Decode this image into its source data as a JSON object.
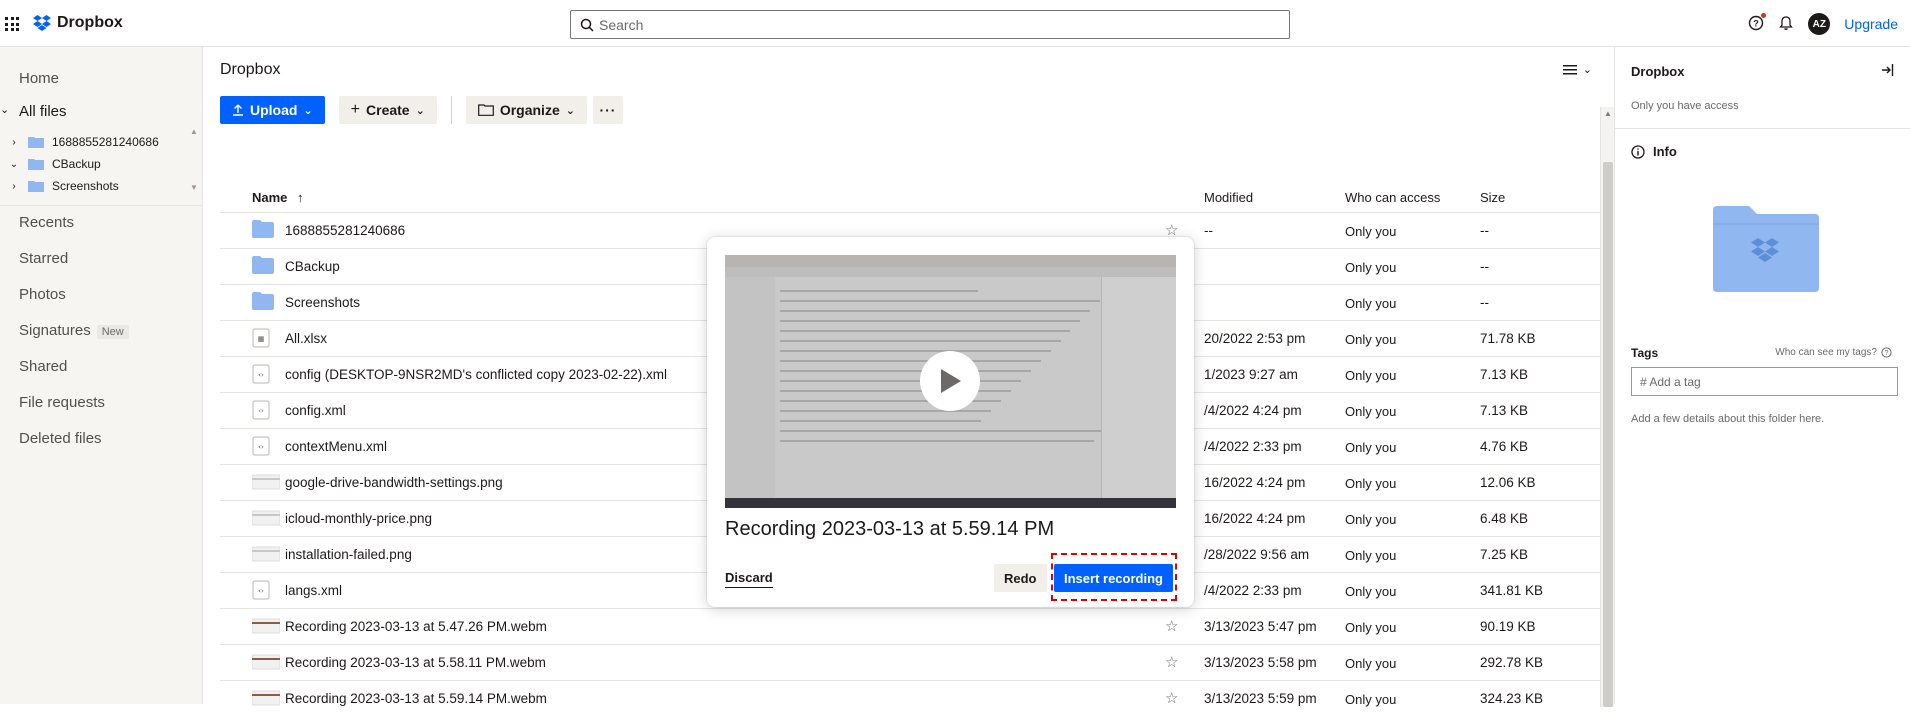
{
  "app": {
    "brand": "Dropbox"
  },
  "search": {
    "placeholder": "Search"
  },
  "topbar": {
    "avatar": "AZ",
    "upgrade": "Upgrade"
  },
  "sidebar": {
    "home": "Home",
    "all_files": "All files",
    "tree": [
      "1688855281240686",
      "CBackup",
      "Screenshots"
    ],
    "recents": "Recents",
    "starred": "Starred",
    "photos": "Photos",
    "signatures": "Signatures",
    "signatures_badge": "New",
    "shared": "Shared",
    "file_requests": "File requests",
    "deleted": "Deleted files"
  },
  "main": {
    "title": "Dropbox",
    "upload": "Upload",
    "create": "Create",
    "organize": "Organize"
  },
  "table": {
    "headers": {
      "name": "Name",
      "modified": "Modified",
      "access": "Who can access",
      "size": "Size"
    },
    "rows": [
      {
        "name": "1688855281240686",
        "type": "folder",
        "modified": "--",
        "access": "Only you",
        "size": "--"
      },
      {
        "name": "CBackup",
        "type": "folder",
        "modified": "",
        "access": "Only you",
        "size": "--"
      },
      {
        "name": "Screenshots",
        "type": "folder",
        "modified": "",
        "access": "Only you",
        "size": "--"
      },
      {
        "name": "All.xlsx",
        "type": "xlsx",
        "modified": "20/2022 2:53 pm",
        "access": "Only you",
        "size": "71.78 KB"
      },
      {
        "name": "config (DESKTOP-9NSR2MD's conflicted copy 2023-02-22).xml",
        "type": "xml",
        "modified": "1/2023 9:27 am",
        "access": "Only you",
        "size": "7.13 KB"
      },
      {
        "name": "config.xml",
        "type": "xml",
        "modified": "/4/2022 4:24 pm",
        "access": "Only you",
        "size": "7.13 KB"
      },
      {
        "name": "contextMenu.xml",
        "type": "xml",
        "modified": "/4/2022 2:33 pm",
        "access": "Only you",
        "size": "4.76 KB"
      },
      {
        "name": "google-drive-bandwidth-settings.png",
        "type": "png",
        "modified": "16/2022 4:24 pm",
        "access": "Only you",
        "size": "12.06 KB"
      },
      {
        "name": "icloud-monthly-price.png",
        "type": "png",
        "modified": "16/2022 4:24 pm",
        "access": "Only you",
        "size": "6.48 KB"
      },
      {
        "name": "installation-failed.png",
        "type": "png",
        "modified": "/28/2022 9:56 am",
        "access": "Only you",
        "size": "7.25 KB"
      },
      {
        "name": "langs.xml",
        "type": "xml",
        "modified": "/4/2022 2:33 pm",
        "access": "Only you",
        "size": "341.81 KB"
      },
      {
        "name": "Recording 2023-03-13 at 5.47.26 PM.webm",
        "type": "video",
        "modified": "3/13/2023 5:47 pm",
        "access": "Only you",
        "size": "90.19 KB"
      },
      {
        "name": "Recording 2023-03-13 at 5.58.11 PM.webm",
        "type": "video",
        "modified": "3/13/2023 5:58 pm",
        "access": "Only you",
        "size": "292.78 KB"
      },
      {
        "name": "Recording 2023-03-13 at 5.59.14 PM.webm",
        "type": "video",
        "modified": "3/13/2023 5:59 pm",
        "access": "Only you",
        "size": "324.23 KB"
      }
    ]
  },
  "right_panel": {
    "title": "Dropbox",
    "subtitle": "Only you have access",
    "info": "Info",
    "tags_label": "Tags",
    "tags_help": "Who can see my tags?",
    "tag_placeholder": "# Add a tag",
    "details": "Add a few details about this folder here."
  },
  "modal": {
    "title": "Recording 2023-03-13 at 5.59.14 PM",
    "discard": "Discard",
    "redo": "Redo",
    "insert": "Insert recording"
  },
  "colors": {
    "accent": "#0061fe",
    "highlight": "#e00000",
    "sidebar_bg": "#f7f5f2",
    "folder": "#90b7f0"
  }
}
